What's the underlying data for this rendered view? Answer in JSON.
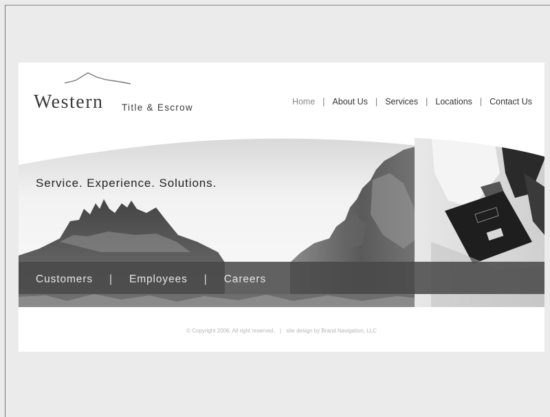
{
  "brand": {
    "name": "Western",
    "subtitle": "Title & Escrow"
  },
  "nav": {
    "items": [
      {
        "label": "Home",
        "active": true
      },
      {
        "label": "About Us"
      },
      {
        "label": "Services"
      },
      {
        "label": "Locations"
      },
      {
        "label": "Contact Us"
      }
    ],
    "separator": "|"
  },
  "hero": {
    "tagline": "Service. Experience. Solutions."
  },
  "subnav": {
    "items": [
      {
        "label": "Customers"
      },
      {
        "label": "Employees"
      },
      {
        "label": "Careers"
      }
    ],
    "separator": "|"
  },
  "footer": {
    "copyright": "© Copyright 2006. All right reserved.",
    "separator": "|",
    "credit": "site design by Brand Navigation, LLC"
  },
  "colors": {
    "page_bg": "#ebebeb",
    "band": "#484848",
    "text": "#333333",
    "active_nav": "#8a8a8a"
  }
}
